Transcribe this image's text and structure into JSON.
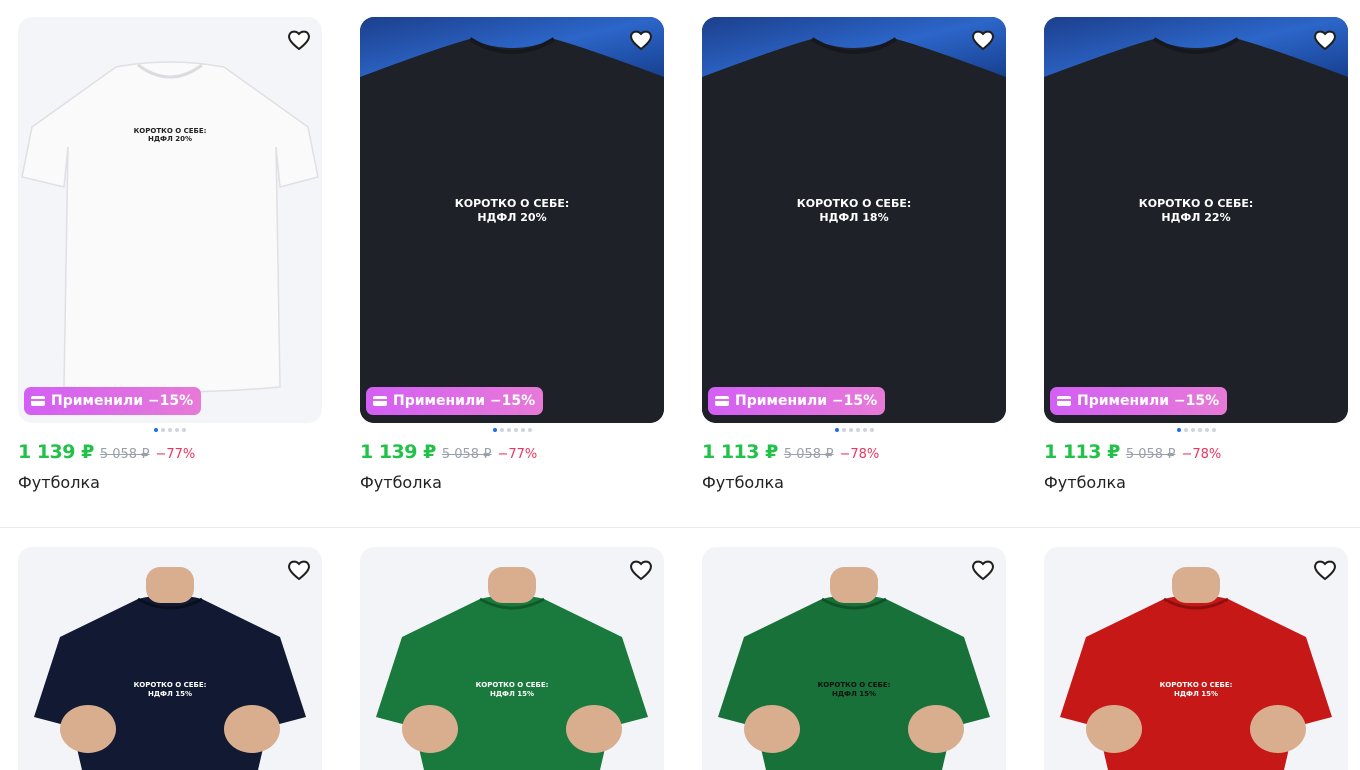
{
  "colors": {
    "price": "#22c24a",
    "discount": "#f0335f",
    "badge": "#d35ff4",
    "dot_active": "#1d6fe6"
  },
  "favorite_icon": "heart-outline-icon",
  "cards": [
    {
      "price": "1 139 ₽",
      "old_price": "5 058 ₽",
      "discount": "−77%",
      "title": "Футболка",
      "badge": "Применили −15%",
      "print_line1": "КОРОТКО О СЕБЕ:",
      "print_line2": "НДФЛ 20%",
      "dots": 5
    },
    {
      "price": "1 139 ₽",
      "old_price": "5 058 ₽",
      "discount": "−77%",
      "title": "Футболка",
      "badge": "Применили −15%",
      "print_line1": "КОРОТКО О СЕБЕ:",
      "print_line2": "НДФЛ 20%",
      "dots": 6
    },
    {
      "price": "1 113 ₽",
      "old_price": "5 058 ₽",
      "discount": "−78%",
      "title": "Футболка",
      "badge": "Применили −15%",
      "print_line1": "КОРОТКО О СЕБЕ:",
      "print_line2": "НДФЛ 18%",
      "dots": 6
    },
    {
      "price": "1 113 ₽",
      "old_price": "5 058 ₽",
      "discount": "−78%",
      "title": "Футболка",
      "badge": "Применили −15%",
      "print_line1": "КОРОТКО О СЕБЕ:",
      "print_line2": "НДФЛ 22%",
      "dots": 6
    },
    {
      "print_line1": "КОРОТКО О СЕБЕ:",
      "print_line2": "НДФЛ 15%",
      "shirt_color": "#121a33"
    },
    {
      "print_line1": "КОРОТКО О СЕБЕ:",
      "print_line2": "НДФЛ 15%",
      "shirt_color": "#1a7a3d"
    },
    {
      "print_line1": "КОРОТКО О СЕБЕ:",
      "print_line2": "НДФЛ 15%",
      "shirt_color": "#177138"
    },
    {
      "print_line1": "КОРОТКО О СЕБЕ:",
      "print_line2": "НДФЛ 15%",
      "shirt_color": "#c71818"
    }
  ]
}
